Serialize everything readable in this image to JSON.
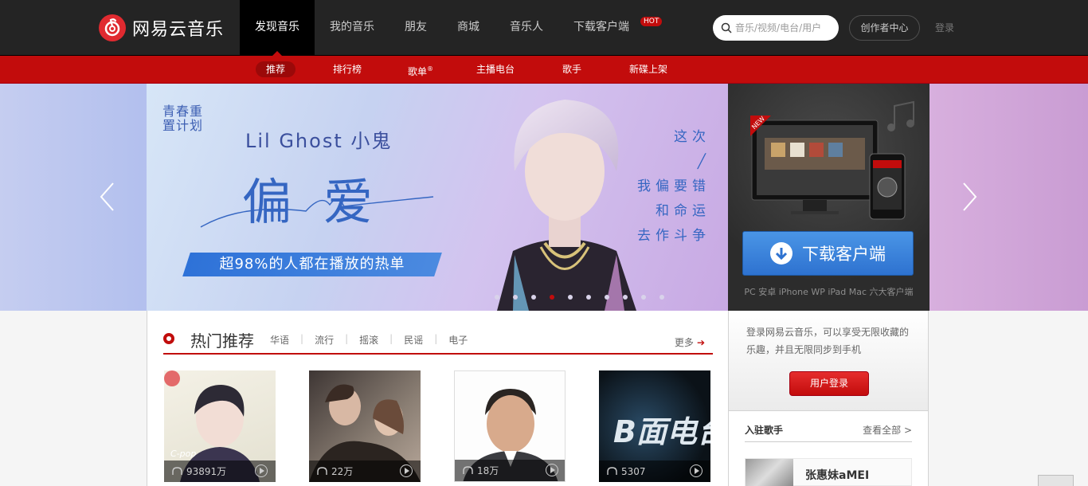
{
  "header": {
    "logo_text": "网易云音乐",
    "nav": [
      {
        "label": "发现音乐",
        "active": true
      },
      {
        "label": "我的音乐"
      },
      {
        "label": "朋友"
      },
      {
        "label": "商城"
      },
      {
        "label": "音乐人"
      },
      {
        "label": "下载客户端",
        "badge": "HOT"
      }
    ],
    "search_placeholder": "音乐/视频/电台/用户",
    "creator_label": "创作者中心",
    "login_label": "登录"
  },
  "subnav": [
    {
      "label": "推荐",
      "active": true
    },
    {
      "label": "排行榜"
    },
    {
      "label": "歌单"
    },
    {
      "label": "主播电台"
    },
    {
      "label": "歌手"
    },
    {
      "label": "新碟上架"
    }
  ],
  "subnav_sup": "®",
  "banner": {
    "tag": "青春重置计划",
    "artist": "Lil Ghost 小鬼",
    "title": "偏爱",
    "subtitle": "超98%的人都在播放的热单",
    "lyrics": [
      "这次",
      "╱",
      "我偏要错",
      "",
      "和命运",
      "去作斗争"
    ],
    "dot_count": 10,
    "active_dot": 3
  },
  "download": {
    "new_badge": "NEW",
    "button_label": "下载客户端",
    "caption": "PC 安卓 iPhone WP iPad Mac 六大客户端"
  },
  "hot": {
    "title": "热门推荐",
    "tags": [
      "华语",
      "流行",
      "摇滚",
      "民谣",
      "电子"
    ],
    "more_label": "更多",
    "cards": [
      {
        "plays": "93891万",
        "overlay": "C-pop"
      },
      {
        "plays": "22万"
      },
      {
        "plays": "18万"
      },
      {
        "plays": "5307",
        "overlay": "B面电台"
      }
    ]
  },
  "side": {
    "login_desc": "登录网易云音乐，可以享受无限收藏的乐趣，并且无限同步到手机",
    "login_button": "用户登录",
    "singers_title": "入驻歌手",
    "singers_all": "查看全部 >",
    "first_singer": "张惠妹aMEI"
  },
  "colors": {
    "brand_red": "#c20c0c",
    "topbar": "#242424",
    "download_blue": "#2e72d0"
  }
}
